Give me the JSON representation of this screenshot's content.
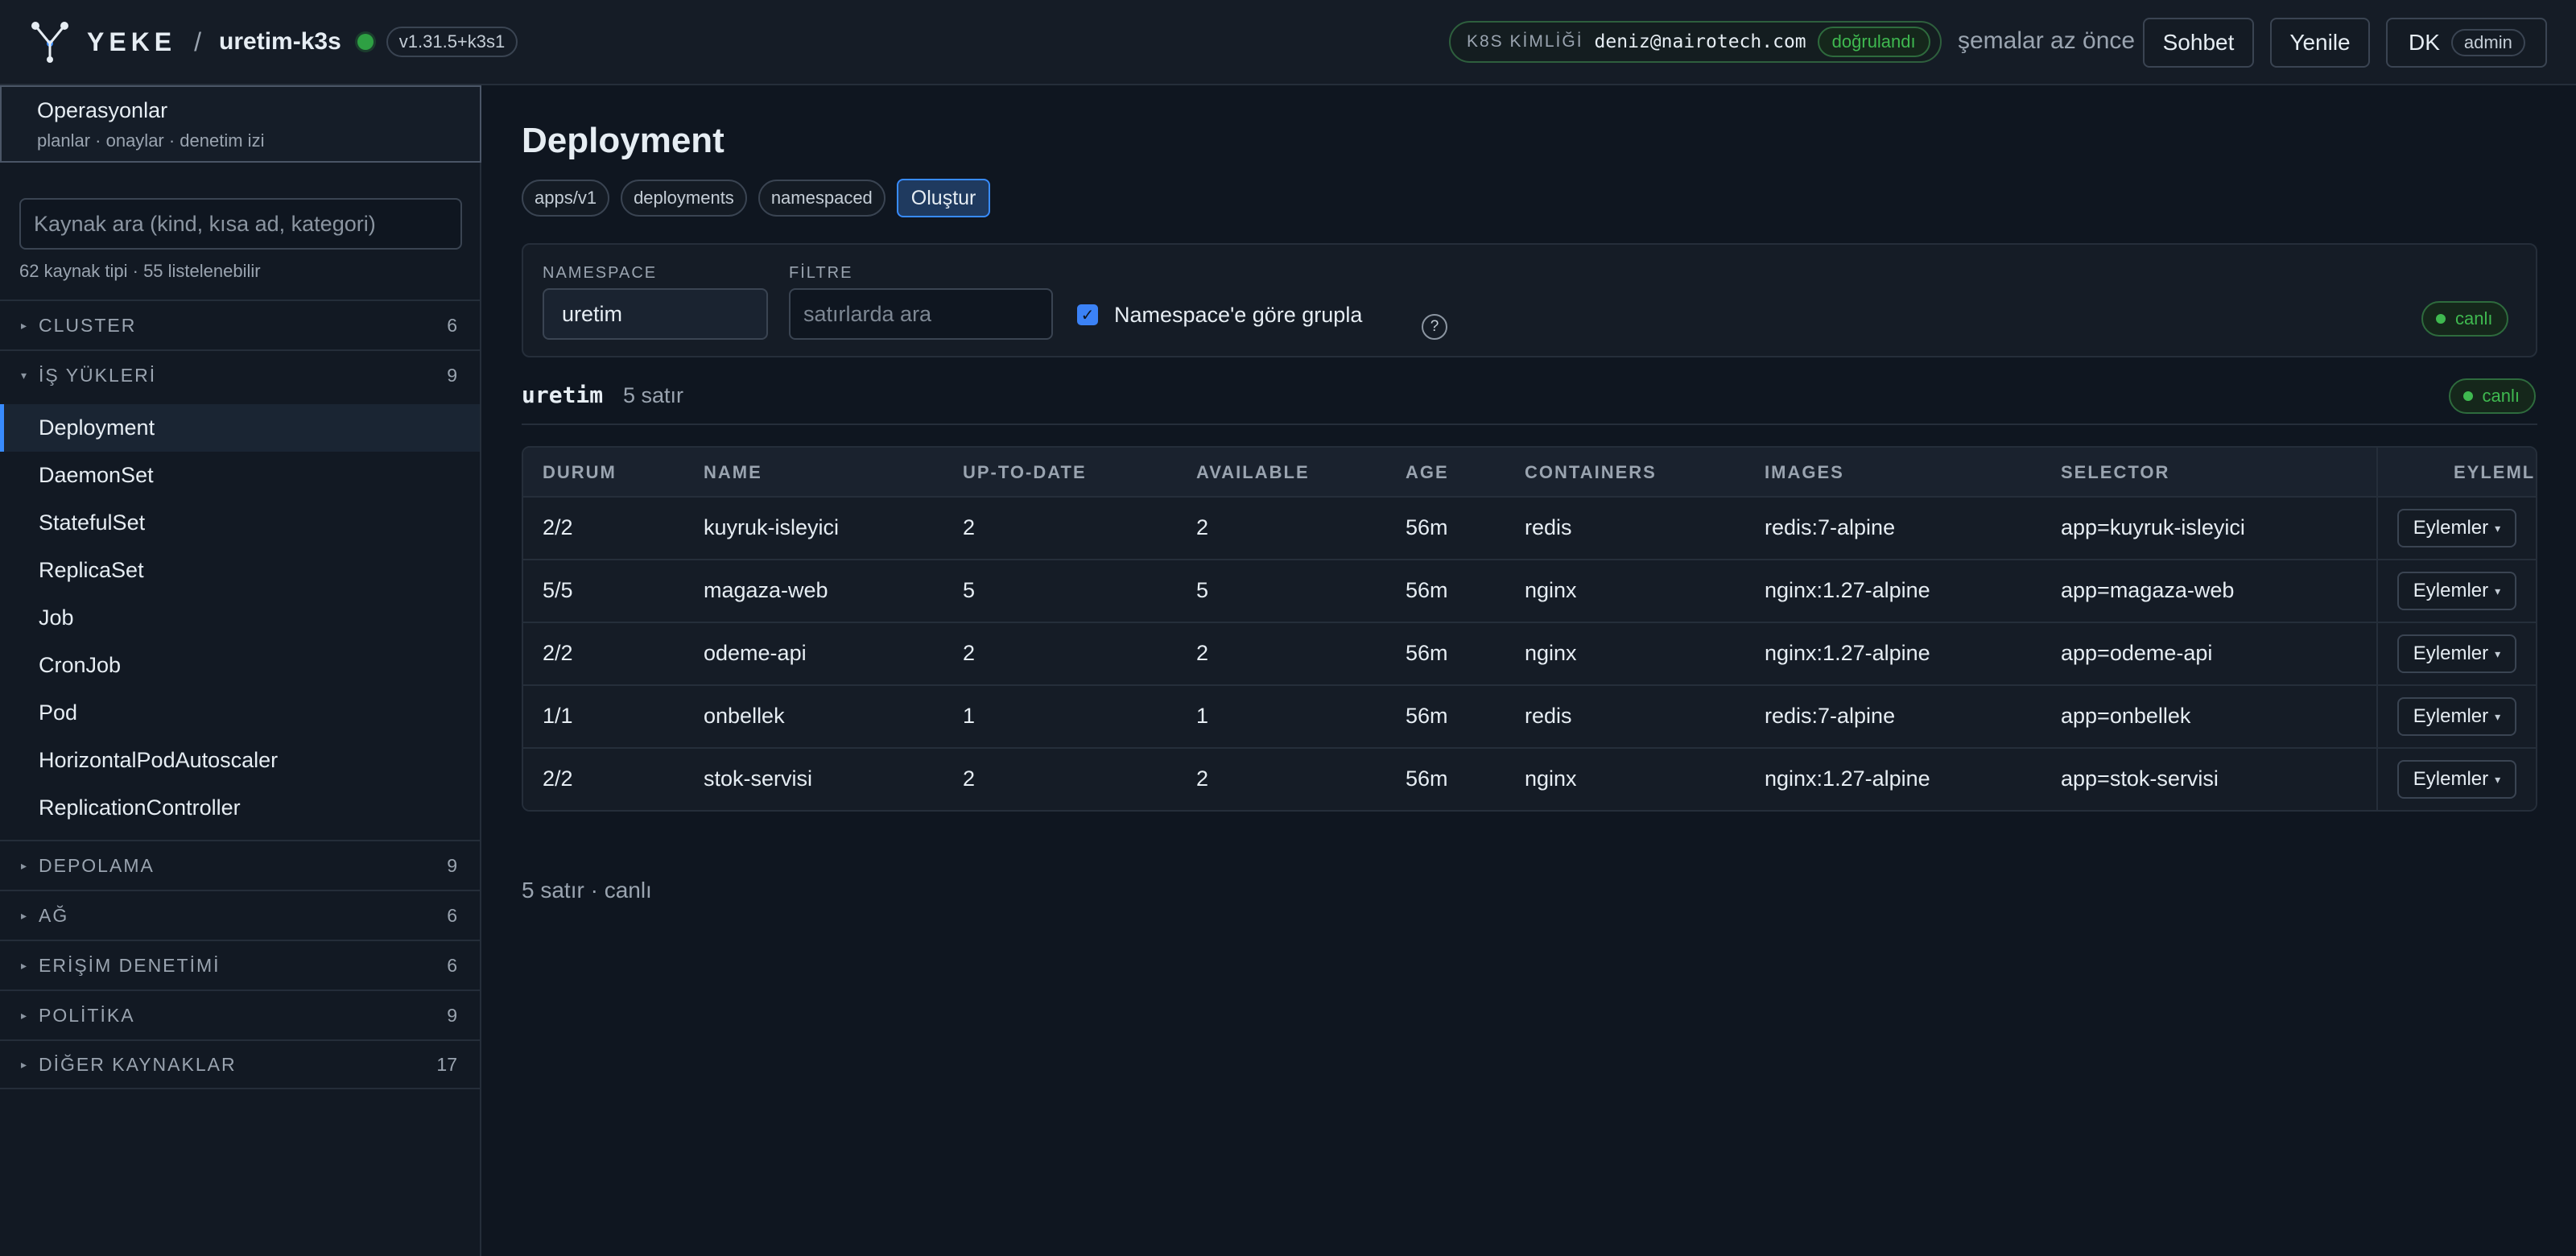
{
  "header": {
    "brand": "YEKE",
    "separator": "/",
    "cluster": "uretim-k3s",
    "version": "v1.31.5+k3s1",
    "identity_label": "K8S KİMLİĞİ",
    "identity_email": "deniz@nairotech.com",
    "identity_status": "doğrulandı",
    "schema_status": "şemalar az önce",
    "chat_label": "Sohbet",
    "refresh_label": "Yenile",
    "user_initials": "DK",
    "user_role": "admin",
    "colors": {
      "accent": "#388bfd",
      "ok": "#3fb950"
    }
  },
  "sidebar": {
    "ops_title": "Operasyonlar",
    "ops_subtitle": "planlar · onaylar · denetim izi",
    "search_placeholder": "Kaynak ara (kind, kısa ad, kategori)",
    "resource_count": "62 kaynak tipi · 55 listelenebilir",
    "categories": [
      {
        "label": "CLUSTER",
        "count": "6"
      },
      {
        "label": "İŞ YÜKLERİ",
        "count": "9"
      },
      {
        "label": "DEPOLAMA",
        "count": "9"
      },
      {
        "label": "AĞ",
        "count": "6"
      },
      {
        "label": "ERİŞİM DENETİMİ",
        "count": "6"
      },
      {
        "label": "POLİTİKA",
        "count": "9"
      },
      {
        "label": "DİĞER KAYNAKLAR",
        "count": "17"
      }
    ],
    "workloads": [
      "Deployment",
      "DaemonSet",
      "StatefulSet",
      "ReplicaSet",
      "Job",
      "CronJob",
      "Pod",
      "HorizontalPodAutoscaler",
      "ReplicationController"
    ]
  },
  "main": {
    "title": "Deployment",
    "tags": [
      "apps/v1",
      "deployments",
      "namespaced"
    ],
    "create_label": "Oluştur",
    "filters": {
      "namespace_label": "NAMESPACE",
      "namespace_value": "uretim",
      "filter_label": "FİLTRE",
      "filter_placeholder": "satırlarda ara",
      "group_label": "Namespace'e göre grupla",
      "group_checked": true,
      "help": "?",
      "live": "canlı"
    },
    "group": {
      "name": "uretim",
      "rows": "5 satır",
      "live": "canlı"
    },
    "table": {
      "columns": [
        "DURUM",
        "NAME",
        "UP-TO-DATE",
        "AVAILABLE",
        "AGE",
        "CONTAINERS",
        "IMAGES",
        "SELECTOR",
        "EYLEMLER"
      ],
      "rows": [
        {
          "durum": "2/2",
          "name": "kuyruk-isleyici",
          "uptodate": "2",
          "available": "2",
          "age": "56m",
          "containers": "redis",
          "images": "redis:7-alpine",
          "selector": "app=kuyruk-isleyici"
        },
        {
          "durum": "5/5",
          "name": "magaza-web",
          "uptodate": "5",
          "available": "5",
          "age": "56m",
          "containers": "nginx",
          "images": "nginx:1.27-alpine",
          "selector": "app=magaza-web"
        },
        {
          "durum": "2/2",
          "name": "odeme-api",
          "uptodate": "2",
          "available": "2",
          "age": "56m",
          "containers": "nginx",
          "images": "nginx:1.27-alpine",
          "selector": "app=odeme-api"
        },
        {
          "durum": "1/1",
          "name": "onbellek",
          "uptodate": "1",
          "available": "1",
          "age": "56m",
          "containers": "redis",
          "images": "redis:7-alpine",
          "selector": "app=onbellek"
        },
        {
          "durum": "2/2",
          "name": "stok-servisi",
          "uptodate": "2",
          "available": "2",
          "age": "56m",
          "containers": "nginx",
          "images": "nginx:1.27-alpine",
          "selector": "app=stok-servisi"
        }
      ],
      "action_label": "Eylemler"
    },
    "footer": "5 satır · canlı"
  }
}
